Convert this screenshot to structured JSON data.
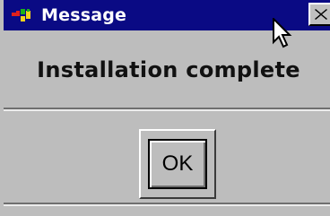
{
  "window": {
    "title": "Message",
    "titlebar_color": "#0a0a84",
    "background_color": "#bdbdbd",
    "app_icon": "colored-app-icon",
    "close_icon": "close-x-icon"
  },
  "dialog": {
    "message": "Installation complete",
    "ok_label": "OK"
  },
  "cursor": {
    "icon": "arrow-pointer-icon"
  }
}
